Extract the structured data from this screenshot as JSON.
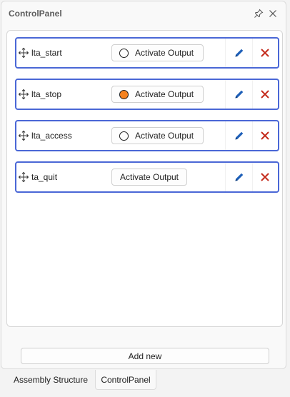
{
  "panel": {
    "title": "ControlPanel"
  },
  "rows": [
    {
      "name": "lta_start",
      "button_label": "Activate Output",
      "indicator": "off"
    },
    {
      "name": "lta_stop",
      "button_label": "Activate Output",
      "indicator": "on"
    },
    {
      "name": "lta_access",
      "button_label": "Activate Output",
      "indicator": "off"
    },
    {
      "name": "ta_quit",
      "button_label": "Activate Output",
      "indicator": "none"
    }
  ],
  "add_button": {
    "label": "Add new"
  },
  "tabs": [
    {
      "label": "Assembly Structure",
      "active": false
    },
    {
      "label": "ControlPanel",
      "active": true
    }
  ],
  "colors": {
    "row_border": "#4a67d6",
    "indicator_on": "#f5821f",
    "edit_icon": "#1e5fb8",
    "delete_icon": "#c42b1c"
  },
  "icons": {
    "move": "move-icon",
    "edit": "pencil-icon",
    "delete": "x-icon",
    "pin": "pin-icon",
    "close": "close-icon"
  }
}
